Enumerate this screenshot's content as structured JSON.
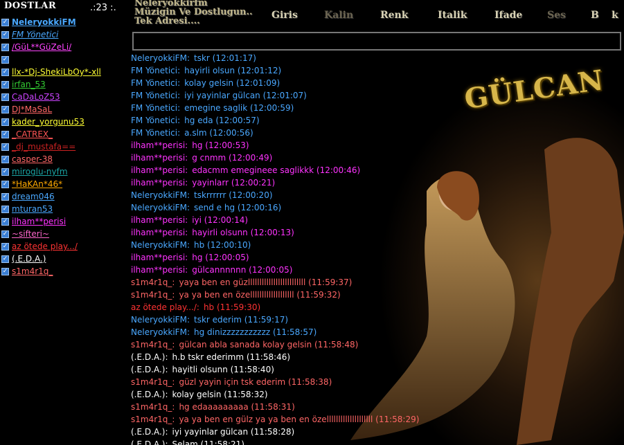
{
  "sidebar": {
    "title": "DOSTLAR",
    "counter": ".:23 :.",
    "users": [
      {
        "name": "NeleryokkiFM",
        "color": "#4aa8ff",
        "bold": true
      },
      {
        "name": "FM Yönetici",
        "color": "#4aa8ff",
        "italic": true
      },
      {
        "name": "/GüL**GüZeLi/",
        "color": "#ff44ff"
      },
      {
        "name": "",
        "color": "#ffffff"
      },
      {
        "name": "llx-*Dj-ShekiLbOy*-xll",
        "color": "#ffff33"
      },
      {
        "name": "irfan_53",
        "color": "#33cc33"
      },
      {
        "name": "CaDaLoZ53",
        "color": "#cc44ff"
      },
      {
        "name": "DJ*MaSaL",
        "color": "#ff6666"
      },
      {
        "name": "kader_yorgunu53",
        "color": "#ffff33"
      },
      {
        "name": "_CATREX_",
        "color": "#ff5555"
      },
      {
        "name": "_dj_mustafa==",
        "color": "#cc2222"
      },
      {
        "name": "casper-38",
        "color": "#ff6666"
      },
      {
        "name": "miroglu-nyfm",
        "color": "#1aa6a6"
      },
      {
        "name": "*HaKAn*46*",
        "color": "#ffaa00"
      },
      {
        "name": "dream046",
        "color": "#4aa8ff"
      },
      {
        "name": "mturan53",
        "color": "#4aa8ff"
      },
      {
        "name": "ilham**perisi",
        "color": "#ff33ff"
      },
      {
        "name": "~sifteri~",
        "color": "#ff66cc"
      },
      {
        "name": "az ötede play.../",
        "color": "#ff3333"
      },
      {
        "name": "(.E.D.A.)",
        "color": "#ffffff"
      },
      {
        "name": "s1m4r1q_",
        "color": "#ff6666"
      }
    ]
  },
  "toolbar": {
    "logo_lines": [
      "Neleryokkirfm",
      "Müzigin Ve Dostlugun..",
      "Tek Adresi...."
    ],
    "giris": "Giris",
    "kalin": "Kalin",
    "renk": "Renk",
    "italik": "Italik",
    "ifade": "Ifade",
    "ses": "Ses",
    "b": "B",
    "k": "k"
  },
  "background_text": "GÜLCAN",
  "messages": [
    {
      "nick": "NeleryokkiFM:",
      "text": "tskr (12:01:17)",
      "color": "#4aa8ff"
    },
    {
      "nick": "FM Yönetici:",
      "text": "hayirli olsun (12:01:12)",
      "color": "#4aa8ff"
    },
    {
      "nick": "FM Yönetici:",
      "text": "kolay gelsin (12:01:09)",
      "color": "#4aa8ff"
    },
    {
      "nick": "FM Yönetici:",
      "text": "iyi yayinlar gülcan (12:01:07)",
      "color": "#4aa8ff"
    },
    {
      "nick": "FM Yönetici:",
      "text": "emegine saglik (12:00:59)",
      "color": "#4aa8ff"
    },
    {
      "nick": "FM Yönetici:",
      "text": "hg eda (12:00:57)",
      "color": "#4aa8ff"
    },
    {
      "nick": "FM Yönetici:",
      "text": "a.slm (12:00:56)",
      "color": "#4aa8ff"
    },
    {
      "nick": "ilham**perisi:",
      "text": "hg (12:00:53)",
      "color": "#ff33ff"
    },
    {
      "nick": "ilham**perisi:",
      "text": "g cnmm (12:00:49)",
      "color": "#ff33ff"
    },
    {
      "nick": "ilham**perisi:",
      "text": "edacmm emegineee saglikkk (12:00:46)",
      "color": "#ff33ff"
    },
    {
      "nick": "ilham**perisi:",
      "text": "yayinlarr (12:00:21)",
      "color": "#ff33ff"
    },
    {
      "nick": "NeleryokkiFM:",
      "text": "tskrrrrrr (12:00:20)",
      "color": "#4aa8ff"
    },
    {
      "nick": "NeleryokkiFM:",
      "text": "send e hg (12:00:16)",
      "color": "#4aa8ff"
    },
    {
      "nick": "ilham**perisi:",
      "text": "iyi (12:00:14)",
      "color": "#ff33ff"
    },
    {
      "nick": "ilham**perisi:",
      "text": "hayirli olsunn (12:00:13)",
      "color": "#ff33ff"
    },
    {
      "nick": "NeleryokkiFM:",
      "text": "hb (12:00:10)",
      "color": "#4aa8ff"
    },
    {
      "nick": "ilham**perisi:",
      "text": "hg (12:00:05)",
      "color": "#ff33ff"
    },
    {
      "nick": "ilham**perisi:",
      "text": "gülcannnnnn (12:00:05)",
      "color": "#ff33ff"
    },
    {
      "nick": "s1m4r1q_:",
      "text": "yaya ben en güzlllllllllllllllllllllllll (11:59:37)",
      "color": "#ff6666"
    },
    {
      "nick": "s1m4r1q_:",
      "text": "ya ya ben en özelllllllllllllllllll (11:59:32)",
      "color": "#ff6666"
    },
    {
      "nick": "az ötede play.../:",
      "text": "hb (11:59:30)",
      "color": "#ff3333"
    },
    {
      "nick": "NeleryokkiFM:",
      "text": "tskr  ederim (11:59:17)",
      "color": "#4aa8ff"
    },
    {
      "nick": "NeleryokkiFM:",
      "text": "hg  dinizzzzzzzzzzz (11:58:57)",
      "color": "#4aa8ff"
    },
    {
      "nick": "s1m4r1q_:",
      "text": "gülcan abla sanada kolay gelsin (11:58:48)",
      "color": "#ff6666"
    },
    {
      "nick": "(.E.D.A.):",
      "text": "h.b tskr ederimm (11:58:46)",
      "color": "#ffffff"
    },
    {
      "nick": "(.E.D.A.):",
      "text": "hayitli olsunn (11:58:40)",
      "color": "#ffffff"
    },
    {
      "nick": "s1m4r1q_:",
      "text": "güzl yayin için tsk ederim (11:58:38)",
      "color": "#ff6666"
    },
    {
      "nick": "(.E.D.A.):",
      "text": "kolay gelsin (11:58:32)",
      "color": "#ffffff"
    },
    {
      "nick": "s1m4r1q_:",
      "text": "hg edaaaaaaaaa (11:58:31)",
      "color": "#ff6666"
    },
    {
      "nick": "s1m4r1q_:",
      "text": "ya ya ben en gülz ya ya ben en özellllllllllllllllllll (11:58:29)",
      "color": "#ff6666"
    },
    {
      "nick": "(.E.D.A.):",
      "text": "iyi yayinlar gülcan (11:58:28)",
      "color": "#ffffff"
    },
    {
      "nick": "(.E.D.A.):",
      "text": "Selam (11:58:21)",
      "color": "#ffffff"
    }
  ]
}
